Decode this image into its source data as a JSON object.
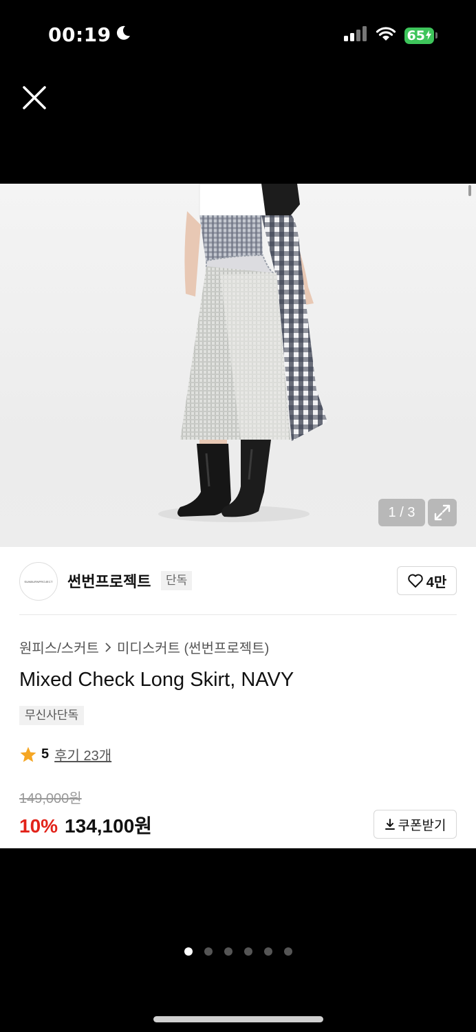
{
  "status_bar": {
    "time": "00:19",
    "battery": "65"
  },
  "image_viewer": {
    "counter": "1 / 3"
  },
  "brand": {
    "logo_text": "SUNBURNPROJECT",
    "name": "썬번프로젝트",
    "tag": "단독",
    "likes": "4만"
  },
  "breadcrumb": {
    "category": "원피스/스커트",
    "subcategory": "미디스커트 (썬번프로젝트)"
  },
  "product": {
    "title": "Mixed Check Long Skirt, NAVY",
    "badge": "무신사단독",
    "rating": "5",
    "review_label": "후기 23개",
    "original_price": "149,000원",
    "discount": "10%",
    "sale_price": "134,100원",
    "coupon_label": "쿠폰받기"
  },
  "pager": {
    "total": 6,
    "active_index": 0
  },
  "colors": {
    "discount": "#e2231a",
    "battery": "#3ec55b",
    "star": "#f5a623"
  }
}
